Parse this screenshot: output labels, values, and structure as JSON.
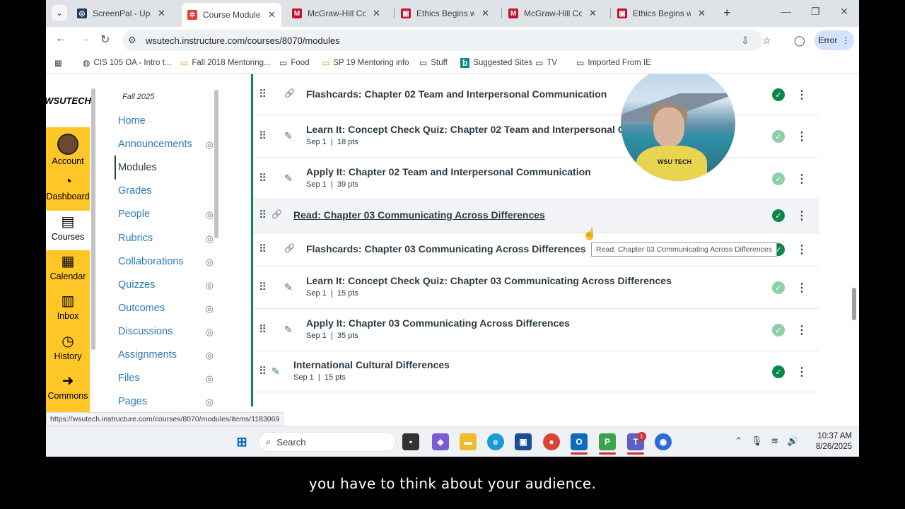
{
  "browser": {
    "tabs": [
      {
        "title": "ScreenPal - Upgra",
        "favicon_color": "#1f3a5f",
        "favicon": "◎"
      },
      {
        "title": "Course Modules: B",
        "favicon_color": "#e63e30",
        "favicon": "✲",
        "active": true
      },
      {
        "title": "McGraw-Hill Conn",
        "favicon_color": "#c8102e",
        "favicon": "M"
      },
      {
        "title": "Ethics Begins with",
        "favicon_color": "#c8102e",
        "favicon": "▣"
      },
      {
        "title": "McGraw-Hill Conn",
        "favicon_color": "#c8102e",
        "favicon": "M"
      },
      {
        "title": "Ethics Begins with",
        "favicon_color": "#c8102e",
        "favicon": "▣"
      }
    ],
    "url": "wsutech.instructure.com/courses/8070/modules",
    "profile_button": "Error",
    "bookmarks": [
      {
        "label": "CIS 105 OA - Intro t...",
        "icon": "globe-icon"
      },
      {
        "label": "Fall 2018 Mentoring...",
        "icon": "folder-icon"
      },
      {
        "label": "Food",
        "icon": "folder-icon"
      },
      {
        "label": "SP 19 Mentoring info",
        "icon": "folder-icon"
      },
      {
        "label": "Stuff",
        "icon": "folder-icon"
      },
      {
        "label": "Suggested Sites",
        "icon": "bing-icon"
      },
      {
        "label": "TV",
        "icon": "folder-icon"
      },
      {
        "label": "Imported From IE",
        "icon": "folder-icon"
      }
    ]
  },
  "global_nav": {
    "logo": "WSUTECH",
    "items": [
      "Account",
      "Dashboard",
      "Courses",
      "Calendar",
      "Inbox",
      "History",
      "Commons"
    ],
    "active": "Courses"
  },
  "course_nav": {
    "term": "Fall 2025",
    "items": [
      {
        "label": "Home",
        "hidden": false
      },
      {
        "label": "Announcements",
        "hidden": true
      },
      {
        "label": "Modules",
        "hidden": false,
        "active": true
      },
      {
        "label": "Grades",
        "hidden": false
      },
      {
        "label": "People",
        "hidden": true
      },
      {
        "label": "Rubrics",
        "hidden": true
      },
      {
        "label": "Collaborations",
        "hidden": true
      },
      {
        "label": "Quizzes",
        "hidden": true
      },
      {
        "label": "Outcomes",
        "hidden": true
      },
      {
        "label": "Discussions",
        "hidden": true
      },
      {
        "label": "Assignments",
        "hidden": true
      },
      {
        "label": "Files",
        "hidden": true
      },
      {
        "label": "Pages",
        "hidden": true
      }
    ]
  },
  "modules": {
    "items": [
      {
        "title": "Flashcards: Chapter 02 Team and Interpersonal Communication",
        "meta": "",
        "type": "link",
        "indent": true,
        "status": "complete"
      },
      {
        "title": "Learn It: Concept Check Quiz: Chapter 02 Team and Interpersonal Com",
        "meta": "Sep 1  |  18 pts",
        "type": "assignment",
        "indent": true,
        "status": "complete-light"
      },
      {
        "title": "Apply It: Chapter 02 Team and Interpersonal Communication",
        "meta": "Sep 1  |  39 pts",
        "type": "assignment",
        "indent": true,
        "status": "complete-light"
      },
      {
        "title": "Read: Chapter 03 Communicating Across Differences",
        "meta": "",
        "type": "link",
        "indent": false,
        "status": "complete",
        "hover": true
      },
      {
        "title": "Flashcards: Chapter 03 Communicating Across Differences",
        "meta": "",
        "type": "link",
        "indent": true,
        "status": "complete"
      },
      {
        "title": "Learn It: Concept Check Quiz: Chapter 03 Communicating Across Differences",
        "meta": "Sep 1  |  15 pts",
        "type": "assignment",
        "indent": true,
        "status": "complete-light"
      },
      {
        "title": "Apply It: Chapter 03 Communicating Across Differences",
        "meta": "Sep 1  |  35 pts",
        "type": "assignment",
        "indent": true,
        "status": "complete-light"
      },
      {
        "title": "International Cultural Differences",
        "meta": "Sep 1  |  15 pts",
        "type": "assignment",
        "indent": false,
        "status": "complete"
      }
    ],
    "tooltip": "Read: Chapter 03 Communicating Across Differences"
  },
  "status_bar_url": "https://wsutech.instructure.com/courses/8070/modules/items/1183069",
  "taskbar": {
    "search_placeholder": "Search",
    "time": "10:37 AM",
    "date": "8/26/2025",
    "teams_badge": "1"
  },
  "caption": "you have to think about your audience.",
  "colors": {
    "canvas_gold": "#ffc627",
    "complete_green": "#0b874b",
    "link_blue": "#2b7abc"
  }
}
